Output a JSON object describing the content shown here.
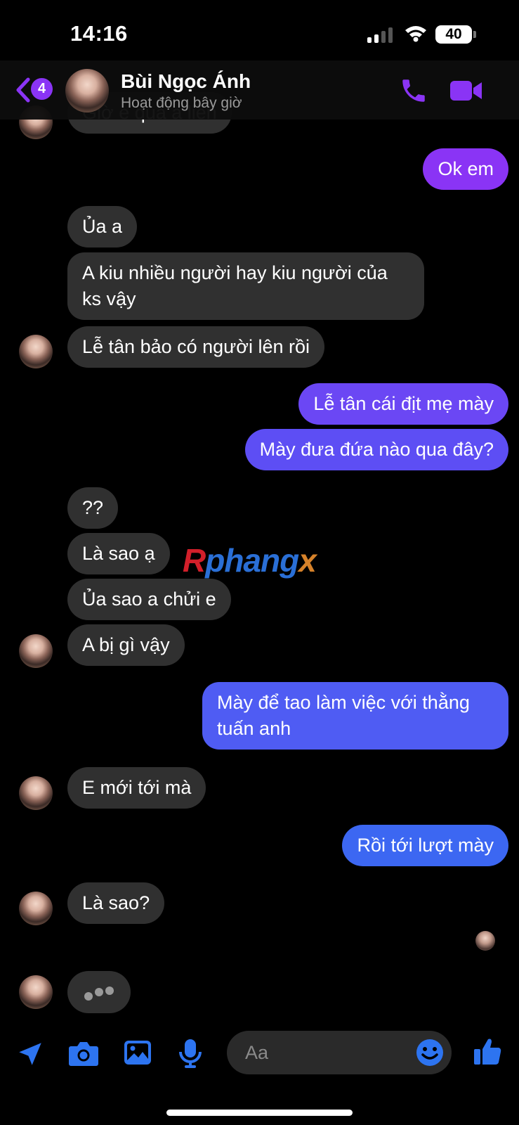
{
  "status_bar": {
    "time": "14:16",
    "battery": "40"
  },
  "header": {
    "back_badge": "4",
    "contact_name": "Bùi Ngọc Ánh",
    "contact_status": "Hoạt động bây giờ",
    "accent_color": "#8a34f5"
  },
  "messages": [
    {
      "from": "them",
      "text": "Giờ e qua a liền"
    },
    {
      "from": "me",
      "text": "Ok em"
    },
    {
      "from": "them",
      "text": "Ủa a"
    },
    {
      "from": "them",
      "text": "A kiu nhiều người hay kiu người của ks vậy"
    },
    {
      "from": "them",
      "text": "Lễ tân bảo có người lên rồi"
    },
    {
      "from": "me",
      "text": "Lễ tân cái địt mẹ mày"
    },
    {
      "from": "me",
      "text": "Mày đưa đứa nào qua đây?"
    },
    {
      "from": "them",
      "text": "??"
    },
    {
      "from": "them",
      "text": "Là sao ạ"
    },
    {
      "from": "them",
      "text": "Ủa sao a chửi e"
    },
    {
      "from": "them",
      "text": "A bị gì vậy"
    },
    {
      "from": "me",
      "text": "Mày để tao làm việc với thằng tuấn anh"
    },
    {
      "from": "them",
      "text": "E mới tới mà"
    },
    {
      "from": "me",
      "text": "Rồi tới lượt mày"
    },
    {
      "from": "them",
      "text": "Là sao?"
    }
  ],
  "watermark": {
    "part1": "R",
    "part2": "phang",
    "part3": "x"
  },
  "composer": {
    "placeholder": "Aa"
  },
  "icons": {
    "back": "chevron-left-icon",
    "call": "phone-icon",
    "video": "video-camera-icon",
    "location": "location-arrow-icon",
    "camera": "camera-icon",
    "gallery": "image-icon",
    "voice": "microphone-icon",
    "emoji": "smiley-icon",
    "like": "thumbs-up-icon"
  },
  "colors": {
    "bubble_in": "#303030",
    "bubble_out_top": "#8a34f5",
    "bubble_out_bottom": "#3c67f2",
    "composer_icons": "#2d74f0"
  }
}
